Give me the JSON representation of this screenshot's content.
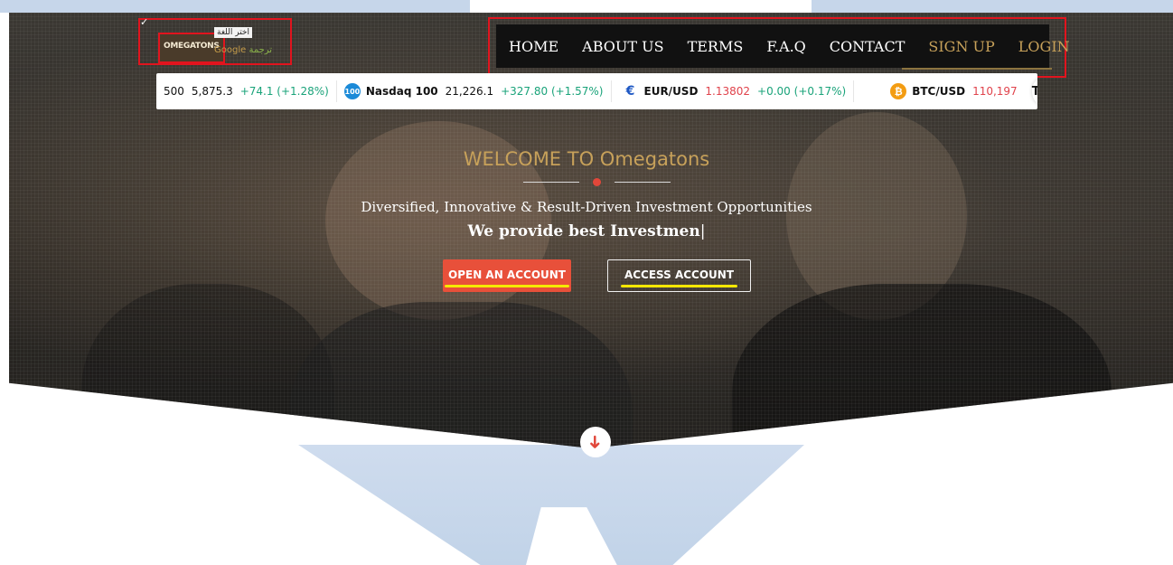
{
  "header": {
    "lang_select": "اختر اللغة",
    "logo_text": "OMEGATONS",
    "google_label": "Google",
    "google_suffix": "ترجمة"
  },
  "nav": {
    "items": [
      {
        "label": "HOME"
      },
      {
        "label": "ABOUT US"
      },
      {
        "label": "TERMS"
      },
      {
        "label": "F.A.Q"
      },
      {
        "label": "CONTACT"
      },
      {
        "label": "SIGN UP"
      },
      {
        "label": "LOGIN"
      }
    ]
  },
  "ticker": {
    "items": [
      {
        "symbol": "500",
        "price": "5,875.3",
        "change": "+74.1 (+1.28%)"
      },
      {
        "badge": "100",
        "symbol": "Nasdaq 100",
        "price": "21,226.1",
        "change": "+327.80 (+1.57%)"
      },
      {
        "symbol": "EUR/USD",
        "price": "1.13802",
        "change": "+0.00 (+0.17%)"
      },
      {
        "badge": "₿",
        "symbol": "BTC/USD",
        "price": "110,197"
      }
    ],
    "tv_logo": "TV"
  },
  "hero": {
    "welcome": "WELCOME TO Omegatons",
    "tagline": "Diversified, Innovative & Result-Driven Investment Opportunities",
    "subtag": "We provide best Investmen",
    "cursor": "|",
    "open_account": "OPEN AN ACCOUNT",
    "access_account": "ACCESS ACCOUNT"
  },
  "colors": {
    "accent_gold": "#c7a15a",
    "cta_red": "#e8503a",
    "annotation_red": "#e1141e",
    "highlight_yellow": "#f5e800"
  }
}
